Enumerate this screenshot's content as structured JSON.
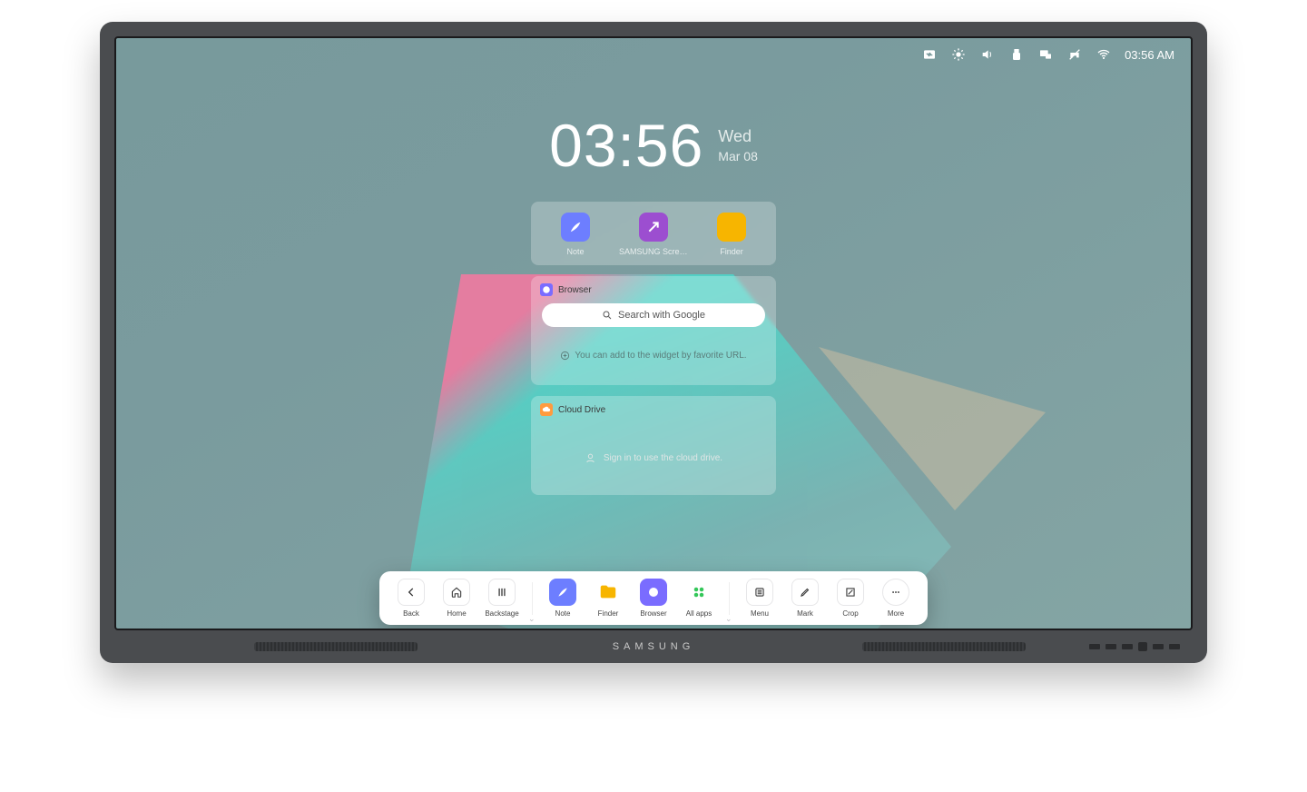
{
  "status": {
    "time": "03:56 AM"
  },
  "clock": {
    "time": "03:56",
    "dow": "Wed",
    "date": "Mar 08"
  },
  "quick_apps": [
    {
      "label": "Note"
    },
    {
      "label": "SAMSUNG Screen..."
    },
    {
      "label": "Finder"
    }
  ],
  "browser": {
    "title": "Browser",
    "search_placeholder": "Search with Google",
    "hint": "You can add to the widget by favorite URL."
  },
  "cloud": {
    "title": "Cloud Drive",
    "hint": "Sign in to use the cloud drive."
  },
  "dock": {
    "nav": [
      {
        "label": "Back"
      },
      {
        "label": "Home"
      },
      {
        "label": "Backstage"
      }
    ],
    "apps": [
      {
        "label": "Note"
      },
      {
        "label": "Finder"
      },
      {
        "label": "Browser"
      },
      {
        "label": "All apps"
      }
    ],
    "tools": [
      {
        "label": "Menu"
      },
      {
        "label": "Mark"
      },
      {
        "label": "Crop"
      },
      {
        "label": "More"
      }
    ]
  },
  "brand": "SAMSUNG"
}
